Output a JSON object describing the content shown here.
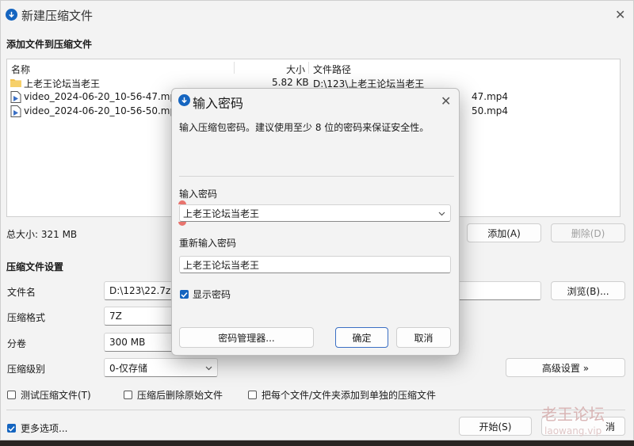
{
  "window": {
    "title": "新建压缩文件",
    "close_symbol": "✕"
  },
  "add_section": {
    "heading": "添加文件到压缩文件"
  },
  "file_list": {
    "headers": {
      "name": "名称",
      "size": "大小",
      "path": "文件路径"
    },
    "rows": [
      {
        "name": "上老王论坛当老王",
        "size": "5.82 KB",
        "path": "D:\\123\\上老王论坛当老王",
        "icon": "folder-icon"
      },
      {
        "name": "video_2024-06-20_10-56-47.mp4",
        "size": "",
        "path": "47.mp4",
        "icon": "video-file-icon"
      },
      {
        "name": "video_2024-06-20_10-56-50.mp4",
        "size": "",
        "path": "50.mp4",
        "icon": "video-file-icon"
      }
    ]
  },
  "total_size": "总大小: 321 MB",
  "buttons": {
    "add": "添加(A)",
    "remove": "删除(D)",
    "browse": "浏览(B)...",
    "advanced": "高级设置 »",
    "start": "开始(S)",
    "cancel_partial": "消"
  },
  "settings": {
    "heading": "压缩文件设置",
    "filename_label": "文件名",
    "filename_value": "D:\\123\\22.7z",
    "format_label": "压缩格式",
    "format_value": "7Z",
    "volume_label": "分卷",
    "volume_value": "300 MB",
    "level_label": "压缩级别",
    "level_value": "0-仅存储"
  },
  "checkboxes": {
    "test": "测试压缩文件(T)",
    "delete_original": "压缩后删除原始文件",
    "separate": "把每个文件/文件夹添加到单独的压缩文件",
    "more_options": "更多选项..."
  },
  "dialog": {
    "title": "输入密码",
    "description": "输入压缩包密码。建议使用至少 8 位的密码来保证安全性。",
    "password_label": "输入密码",
    "password_value": "上老王论坛当老王",
    "repeat_label": "重新输入密码",
    "repeat_value": "上老王论坛当老王",
    "show_password": "显示密码",
    "manager_button": "密码管理器...",
    "ok_button": "确定",
    "cancel_button": "取消",
    "close_symbol": "✕"
  },
  "watermark": {
    "line1": "老王论坛",
    "line2": "laowang.vip"
  },
  "colors": {
    "accent": "#1565c0",
    "window_bg": "#f3f3f3",
    "folder": "#f2c14e"
  }
}
